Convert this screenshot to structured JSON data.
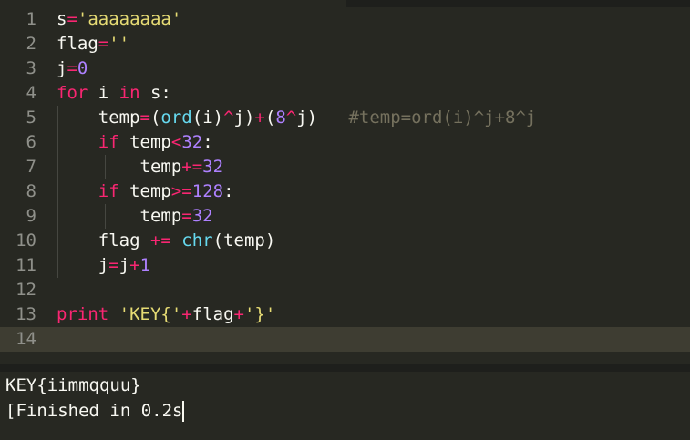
{
  "colors": {
    "background": "#272822",
    "default": "#f8f8f2",
    "keyword": "#f92672",
    "string": "#e6db74",
    "number": "#ae81ff",
    "function": "#66d9ef",
    "comment": "#75715e",
    "line_number": "#8f908a"
  },
  "editor": {
    "lines": [
      {
        "number": "1",
        "tokens": [
          [
            "s",
            "default"
          ],
          [
            "=",
            "keyword"
          ],
          [
            "'aaaaaaaa'",
            "string"
          ]
        ]
      },
      {
        "number": "2",
        "tokens": [
          [
            "flag",
            "default"
          ],
          [
            "=",
            "keyword"
          ],
          [
            "''",
            "string"
          ]
        ]
      },
      {
        "number": "3",
        "tokens": [
          [
            "j",
            "default"
          ],
          [
            "=",
            "keyword"
          ],
          [
            "0",
            "number"
          ]
        ]
      },
      {
        "number": "4",
        "tokens": [
          [
            "for",
            "keyword"
          ],
          [
            " i ",
            "default"
          ],
          [
            "in",
            "keyword"
          ],
          [
            " s:",
            "default"
          ]
        ]
      },
      {
        "number": "5",
        "tokens": [
          [
            "    temp",
            "default"
          ],
          [
            "=",
            "keyword"
          ],
          [
            "(",
            "default"
          ],
          [
            "ord",
            "function"
          ],
          [
            "(i)",
            "default"
          ],
          [
            "^",
            "keyword"
          ],
          [
            "j)",
            "default"
          ],
          [
            "+",
            "keyword"
          ],
          [
            "(",
            "default"
          ],
          [
            "8",
            "number"
          ],
          [
            "^",
            "keyword"
          ],
          [
            "j)",
            "default"
          ],
          [
            "   ",
            "default"
          ],
          [
            "#temp=ord(i)^j+8^j",
            "comment"
          ]
        ]
      },
      {
        "number": "6",
        "tokens": [
          [
            "    ",
            "default"
          ],
          [
            "if",
            "keyword"
          ],
          [
            " temp",
            "default"
          ],
          [
            "<",
            "keyword"
          ],
          [
            "32",
            "number"
          ],
          [
            ":",
            "default"
          ]
        ]
      },
      {
        "number": "7",
        "tokens": [
          [
            "        temp",
            "default"
          ],
          [
            "+=",
            "keyword"
          ],
          [
            "32",
            "number"
          ]
        ]
      },
      {
        "number": "8",
        "tokens": [
          [
            "    ",
            "default"
          ],
          [
            "if",
            "keyword"
          ],
          [
            " temp",
            "default"
          ],
          [
            ">=",
            "keyword"
          ],
          [
            "128",
            "number"
          ],
          [
            ":",
            "default"
          ]
        ]
      },
      {
        "number": "9",
        "tokens": [
          [
            "        temp",
            "default"
          ],
          [
            "=",
            "keyword"
          ],
          [
            "32",
            "number"
          ]
        ]
      },
      {
        "number": "10",
        "tokens": [
          [
            "    flag ",
            "default"
          ],
          [
            "+=",
            "keyword"
          ],
          [
            " ",
            "default"
          ],
          [
            "chr",
            "function"
          ],
          [
            "(temp)",
            "default"
          ]
        ]
      },
      {
        "number": "11",
        "tokens": [
          [
            "    j",
            "default"
          ],
          [
            "=",
            "keyword"
          ],
          [
            "j",
            "default"
          ],
          [
            "+",
            "keyword"
          ],
          [
            "1",
            "number"
          ]
        ]
      },
      {
        "number": "12",
        "tokens": []
      },
      {
        "number": "13",
        "tokens": [
          [
            "print",
            "keyword"
          ],
          [
            " ",
            "default"
          ],
          [
            "'KEY{'",
            "string"
          ],
          [
            "+",
            "keyword"
          ],
          [
            "flag",
            "default"
          ],
          [
            "+",
            "keyword"
          ],
          [
            "'}'",
            "string"
          ]
        ]
      },
      {
        "number": "14",
        "tokens": []
      }
    ]
  },
  "output": {
    "line1": "KEY{iimmqquu}",
    "line2": "[Finished in 0.2s"
  }
}
